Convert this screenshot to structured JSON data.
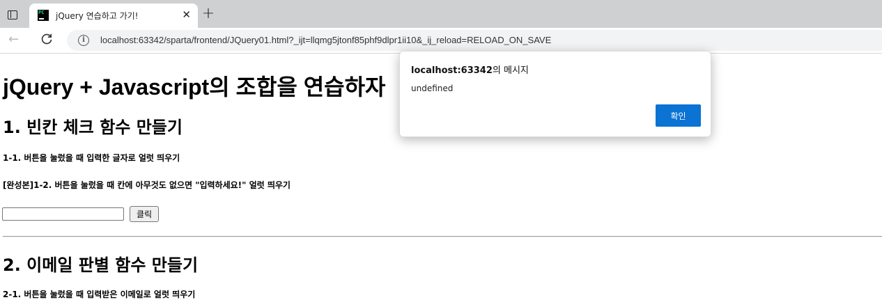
{
  "browser": {
    "tab": {
      "title": "jQuery 연습하고 가기!",
      "favicon_text": "PC",
      "close": "✕"
    },
    "new_tab_glyph": "+",
    "nav": {
      "back_glyph": "←"
    },
    "address": {
      "url": "localhost:63342/sparta/frontend/JQuery01.html?_ijt=llqmg5jtonf85phf9dlpr1ii10&_ij_reload=RELOAD_ON_SAVE",
      "info_glyph": "i"
    }
  },
  "page": {
    "heading": "jQuery + Javascript의 조합을 연습하자",
    "section1": {
      "title": "1. 빈칸 체크 함수 만들기",
      "task1": "1-1. 버튼을 눌렀을 때 입력한 글자로 얼럿 띄우기",
      "task2": "[완성본]1-2. 버튼을 눌렀을 때 칸에 아무것도 없으면 \"입력하세요!\" 얼럿 띄우기",
      "input_value": "",
      "button_label": "클릭"
    },
    "section2": {
      "title": "2. 이메일 판별 함수 만들기",
      "task1": "2-1. 버튼을 눌렀을 때 입력받은 이메일로 얼럿 띄우기"
    }
  },
  "alert": {
    "origin": "localhost:63342",
    "origin_suffix": "의 메시지",
    "message": "undefined",
    "ok_label": "확인"
  },
  "colors": {
    "primary_button": "#0b73d3",
    "tabstrip": "#cfd0d2"
  },
  "icons": [
    "tab-actions-icon",
    "favicon-icon",
    "close-icon",
    "new-tab-icon",
    "back-icon",
    "reload-icon",
    "info-icon"
  ]
}
